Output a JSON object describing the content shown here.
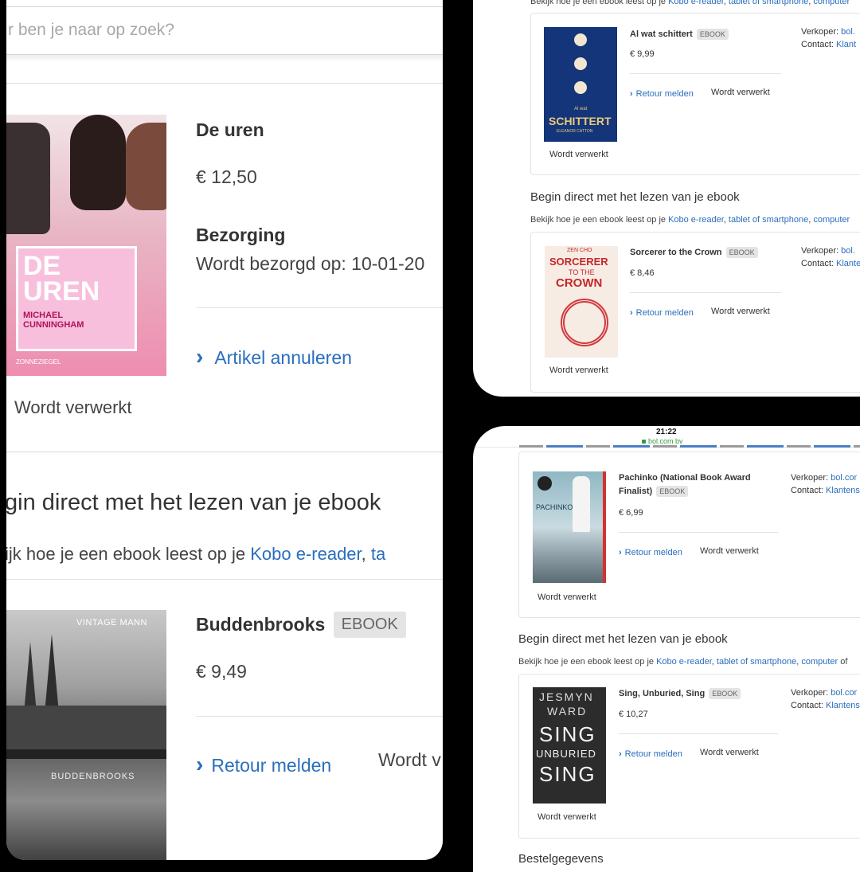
{
  "left": {
    "search_placeholder": "r ben je naar op zoek?",
    "item1": {
      "title": "De uren",
      "price": "€ 12,50",
      "delivery_heading": "Bezorging",
      "delivery_text": "Wordt bezorgd op: 10-01-20",
      "cancel_link": "Artikel annuleren",
      "status": "Wordt verwerkt",
      "cover_title": "DE UREN",
      "cover_author": "MICHAEL CUNNINGHAM",
      "cover_publisher": "ZONNEZIEGEL"
    },
    "ebook_heading": "gin direct met het lezen van je ebook",
    "ebook_sub_prefix": "ijk hoe je een ebook leest op je ",
    "ebook_sub_link1": "Kobo e-reader",
    "ebook_sub_sep": ", ",
    "ebook_sub_link2": "ta",
    "item2": {
      "title": "Buddenbrooks",
      "badge": "EBOOK",
      "price": "€ 9,49",
      "return_link": "Retour melden",
      "status": "Wordt v",
      "cover_series": "VINTAGE MANN",
      "cover_title": "BUDDENBROOKS"
    }
  },
  "top_right": {
    "top_sub_prefix": "Bekijk hoe je een ebook leest op je ",
    "top_sub_link1": "Kobo e-reader",
    "top_sub_link2": "tablet of smartphone",
    "top_sub_link3": "computer",
    "item1": {
      "title": "Al wat schittert",
      "badge": "EBOOK",
      "price": "€ 9,99",
      "seller_label": "Verkoper:",
      "seller": "bol.",
      "contact_label": "Contact:",
      "contact": "Klant",
      "return_link": "Retour melden",
      "status_inline": "Wordt verwerkt",
      "status_under": "Wordt verwerkt",
      "cover_title": "SCHITTERT",
      "cover_small": "Al wat",
      "cover_author": "ELEANOR CATTON"
    },
    "ebook_heading": "Begin direct met het lezen van je ebook",
    "sub_prefix": "Bekijk hoe je een ebook leest op je ",
    "sub_link1": "Kobo e-reader",
    "sub_link2": "tablet of smartphone",
    "sub_link3": "computer",
    "item2": {
      "title": "Sorcerer to the Crown",
      "badge": "EBOOK",
      "price": "€ 8,46",
      "seller_label": "Verkoper:",
      "seller": "bol.",
      "contact_label": "Contact:",
      "contact": "Klante",
      "return_link": "Retour melden",
      "status_inline": "Wordt verwerkt",
      "status_under": "Wordt verwerkt",
      "cover_author": "ZEN CHO",
      "cover_title1": "SORCERER",
      "cover_title2": "TO THE",
      "cover_title3": "CROWN"
    }
  },
  "bottom_right": {
    "time": "21:22",
    "url": "bol.com bv",
    "item1": {
      "title_line1": "Pachinko (National Book Award",
      "title_line2": "Finalist)",
      "badge": "EBOOK",
      "price": "€ 6,99",
      "seller_label": "Verkoper:",
      "seller": "bol.cor",
      "contact_label": "Contact:",
      "contact": "Klantens",
      "return_link": "Retour melden",
      "status_inline": "Wordt verwerkt",
      "status_under": "Wordt verwerkt",
      "cover_title": "PACHINKO"
    },
    "ebook_heading": "Begin direct met het lezen van je ebook",
    "sub_prefix": "Bekijk hoe je een ebook leest op je ",
    "sub_link1": "Kobo e-reader",
    "sub_link2": "tablet of smartphone",
    "sub_link3": "computer",
    "sub_suffix": " of",
    "item2": {
      "title": "Sing, Unburied, Sing",
      "badge": "EBOOK",
      "price": "€ 10,27",
      "seller_label": "Verkoper:",
      "seller": "bol.cor",
      "contact_label": "Contact:",
      "contact": "Klantens",
      "return_link": "Retour melden",
      "status_inline": "Wordt verwerkt",
      "status_under": "Wordt verwerkt",
      "cover_author1": "JESMYN",
      "cover_author2": "WARD",
      "cover_title1": "SING",
      "cover_title2": "UNBURIED",
      "cover_title3": "SING"
    },
    "footer_heading": "Bestelgegevens"
  },
  "icons": {
    "chevron": "›",
    "lock": "lock-icon"
  }
}
